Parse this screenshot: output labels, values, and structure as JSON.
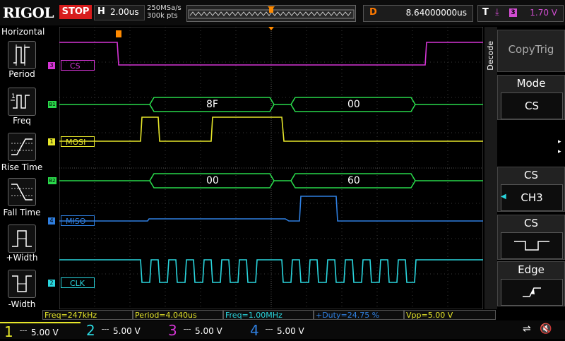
{
  "brand": "RIGOL",
  "run_state": "STOP",
  "horizontal": {
    "label": "H",
    "timebase": "2.00us"
  },
  "sampling": {
    "rate": "250MSa/s",
    "points": "300k pts"
  },
  "delay": {
    "label": "D",
    "value": "8.64000000us"
  },
  "trigger": {
    "label": "T",
    "source_badge": "3",
    "level": "1.70 V"
  },
  "left_menu": {
    "title": "Horizontal",
    "items": [
      {
        "label": "Period",
        "icon": "period-icon"
      },
      {
        "label": "Freq",
        "icon": "freq-icon"
      },
      {
        "label": "Rise Time",
        "icon": "rise-time-icon"
      },
      {
        "label": "Fall Time",
        "icon": "fall-time-icon"
      },
      {
        "label": "+Width",
        "icon": "positive-width-icon"
      },
      {
        "label": "-Width",
        "icon": "negative-width-icon"
      }
    ]
  },
  "channels": {
    "cs": {
      "label": "CS",
      "marker": "3",
      "color": "#d535d5"
    },
    "mosi": {
      "label": "MOSI",
      "marker": "1",
      "color": "#e6e62a"
    },
    "miso": {
      "label": "MISO",
      "marker": "4",
      "color": "#2f7fe0"
    },
    "clk": {
      "label": "CLK",
      "marker": "2",
      "color": "#2ad6de"
    }
  },
  "bus": {
    "b1": {
      "marker": "B1",
      "values": [
        "8F",
        "00"
      ],
      "color": "#29d84a"
    },
    "b2": {
      "marker": "B2",
      "values": [
        "00",
        "60"
      ],
      "color": "#29d84a"
    }
  },
  "right_menu": {
    "side_title": "Decode",
    "top_button": "CopyTrig",
    "mode": {
      "title": "Mode",
      "value": "CS"
    },
    "cs_source": {
      "title": "CS",
      "value": "CH3"
    },
    "cs_polarity": {
      "title": "CS"
    },
    "edge": {
      "title": "Edge"
    }
  },
  "measurements": [
    {
      "text": "Freq=247kHz",
      "color": "#e6e62a"
    },
    {
      "text": "Period=4.040us",
      "color": "#e6e62a"
    },
    {
      "text": "Freq=1.00MHz",
      "color": "#2ad6de"
    },
    {
      "text": "+Duty=24.75 %",
      "color": "#2f7fe0"
    },
    {
      "text": "Vpp=5.00 V",
      "color": "#e6e62a"
    }
  ],
  "channel_scales": [
    {
      "num": "1",
      "value": "5.00 V",
      "color": "#e6e62a"
    },
    {
      "num": "2",
      "value": "5.00 V",
      "color": "#2ad6de"
    },
    {
      "num": "3",
      "value": "5.00 V",
      "color": "#d535d5"
    },
    {
      "num": "4",
      "value": "5.00 V",
      "color": "#2f7fe0"
    }
  ]
}
